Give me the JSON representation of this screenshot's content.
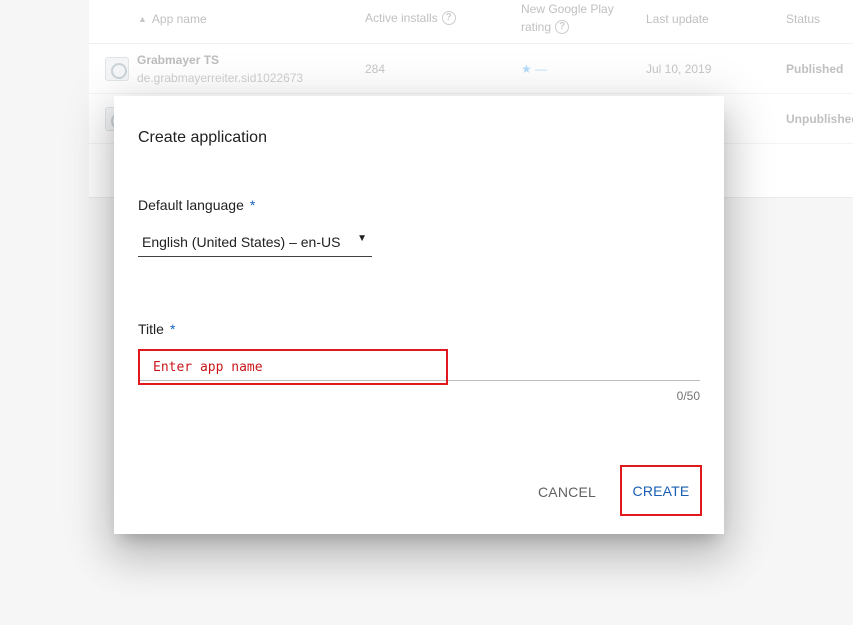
{
  "table": {
    "headers": {
      "app_name": "App name",
      "active_installs": "Active installs",
      "rating_line1": "New Google Play",
      "rating_line2": "rating",
      "last_update": "Last update",
      "status": "Status"
    },
    "rows": [
      {
        "name": "Grabmayer TS",
        "package": "de.grabmayerreiter.sid1022673",
        "installs": "284",
        "rating": "★ —",
        "last_update": "Jul 10, 2019",
        "status": "Published"
      },
      {
        "name": "",
        "package": "",
        "installs": "",
        "rating": "",
        "last_update": "",
        "status": "Unpublished"
      }
    ]
  },
  "dialog": {
    "title": "Create application",
    "language_label": "Default language",
    "required_mark": "*",
    "language_value": "English (United States) – en-US",
    "title_label": "Title",
    "title_placeholder": "Enter app name",
    "title_value": "",
    "counter": "0/50",
    "cancel_label": "CANCEL",
    "create_label": "CREATE"
  },
  "colors": {
    "accent": "#1565c0",
    "highlight_box": "#e0191c"
  }
}
